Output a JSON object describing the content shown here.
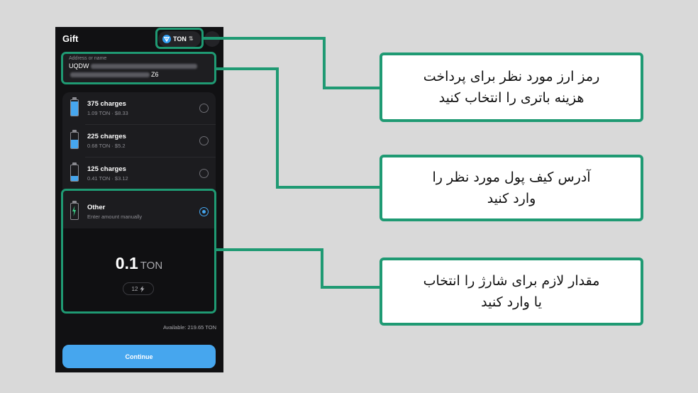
{
  "app": {
    "title": "Gift",
    "currency": {
      "label": "TON",
      "icon": "ton-diamond-icon"
    }
  },
  "address": {
    "label": "Address or name",
    "line1_visible_start": "UQDW",
    "line2_visible_end": "Z6"
  },
  "options": [
    {
      "title": "375 charges",
      "subtitle": "1.09 TON · $8.33",
      "battery_level": 0.9,
      "selected": false
    },
    {
      "title": "225 charges",
      "subtitle": "0.68 TON · $5.2",
      "battery_level": 0.55,
      "selected": false
    },
    {
      "title": "125 charges",
      "subtitle": "0.41 TON · $3.12",
      "battery_level": 0.3,
      "selected": false
    },
    {
      "title": "Other",
      "subtitle": "Enter amount manually",
      "icon": "lightning-icon",
      "selected": true
    }
  ],
  "amount": {
    "value": "0.1",
    "unit": "TON",
    "charges": "12"
  },
  "available": "Available: 219.65 TON",
  "continue_label": "Continue",
  "annotations": {
    "currency": {
      "line1": "رمز ارز مورد نظر برای پرداخت",
      "line2": "هزینه باتری را انتخاب کنید"
    },
    "address": {
      "line1": "آدرس کیف پول مورد نظر را",
      "line2": "وارد کنید"
    },
    "amount": {
      "line1": "مقدار لازم برای شارژ را انتخاب",
      "line2": "یا وارد کنید"
    }
  },
  "colors": {
    "accent": "#46a6ee",
    "annotation_green": "#1f9a73",
    "background": "#d9d9d9",
    "phone_bg": "#111113"
  }
}
